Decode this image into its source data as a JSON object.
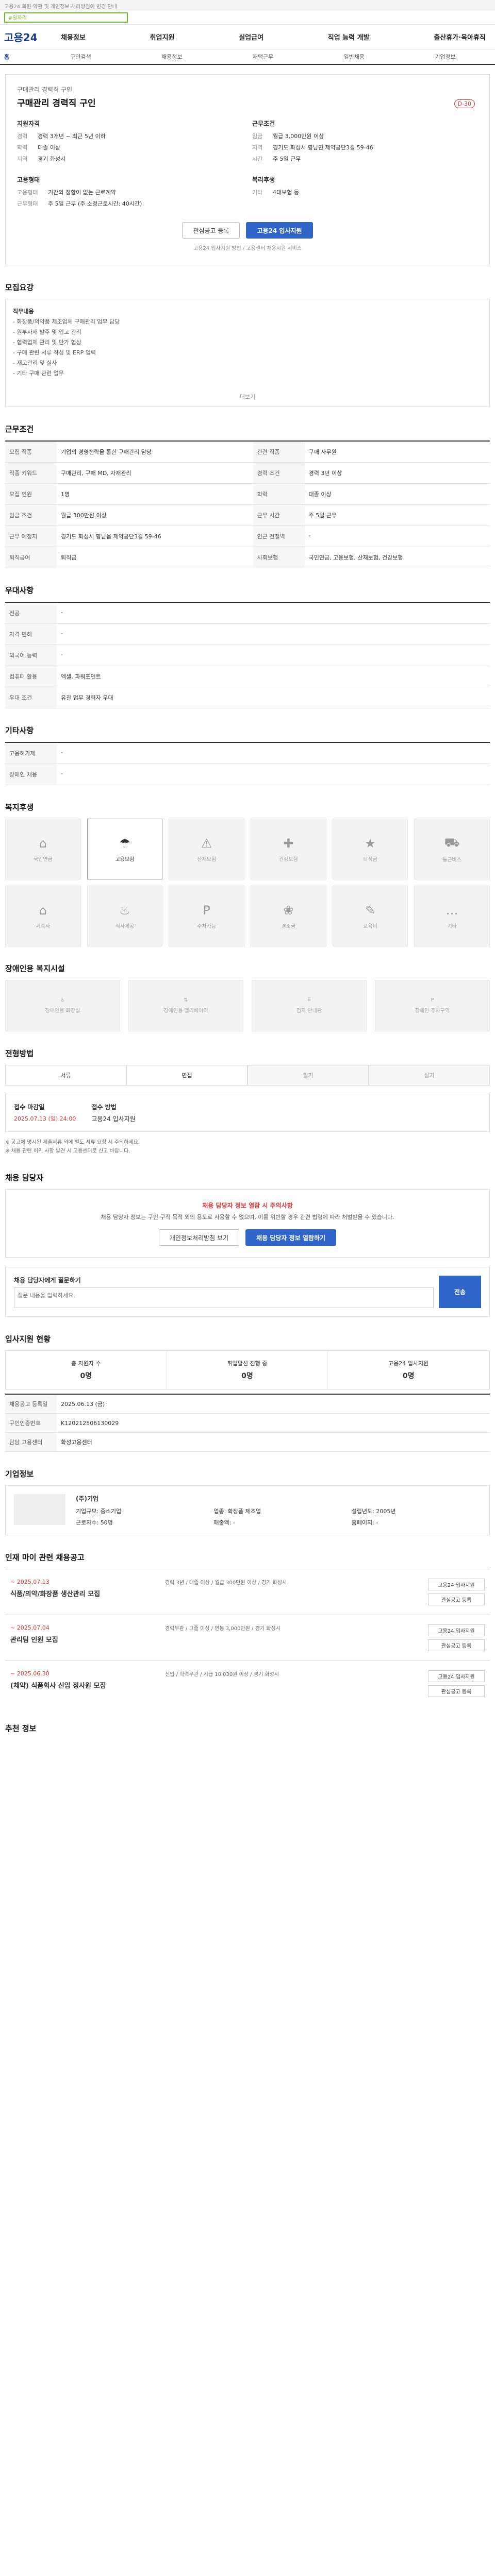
{
  "top_notice": "고용24 회원 약관 및 개인정보 처리방침이 변경 안내",
  "search": {
    "tag": "#일자리"
  },
  "header": {
    "logo": "고용24",
    "gnb": [
      "채용정보",
      "취업지원",
      "실업급여",
      "직업 능력 개발",
      "출산휴가·육아휴직"
    ]
  },
  "subnav": [
    "홈",
    "구인검색",
    "채용정보",
    "재택근무",
    "일반채용",
    "기업정보"
  ],
  "job": {
    "company": "구매관리 경력직 구인",
    "title": "구매관리 경력직 구인",
    "dday": "D-30",
    "left_title": "지원자격",
    "left": [
      [
        "경력",
        "경력 3개년 ~ 최근 5년 이하"
      ],
      [
        "학력",
        "대졸 이상"
      ],
      [
        "지역",
        "경기 화성시"
      ]
    ],
    "right_title": "근무조건",
    "right": [
      [
        "임금",
        "월급 3,000만원 이상"
      ],
      [
        "지역",
        "경기도 화성시 향남면 제약공단3길 59-46"
      ],
      [
        "시간",
        "주 5일 근무"
      ]
    ],
    "left2_title": "고용형태",
    "left2": [
      [
        "고용형태",
        "기간의 정함이 없는 근로계약"
      ],
      [
        "근무형태",
        "주 5일 근무 (주 소정근로시간: 40시간)"
      ]
    ],
    "right2_title": "복리후생",
    "right2": [
      [
        "기타",
        "4대보험 등"
      ]
    ],
    "btn_scrap": "관심공고 등록",
    "btn_apply": "고용24 입사지원",
    "note": "고용24 입사지원 방법 / 고용센터 채용지원 서비스"
  },
  "sections": {
    "recruit_detail": "모집요강",
    "work_cond": "근무조건",
    "qualification": "우대사항",
    "other": "기타사항",
    "welfare": "복지후생",
    "disability": "장애인용 복지시설",
    "apply": "전형방법",
    "manager": "채용 담당자",
    "status": "입사지원 현황",
    "company_info": "기업정보",
    "related": "인재 마이 관련 채용공고",
    "similar": "추천 정보"
  },
  "recruit_text": [
    "직무내용",
    "- 화장품/의약품 제조업체 구매관리 업무 담당",
    "- 원부자재 발주 및 입고 관리",
    "- 협력업체 관리 및 단가 협상",
    "- 구매 관련 서류 작성 및 ERP 입력",
    "- 재고관리 및 실사",
    "- 기타 구매 관련 업무"
  ],
  "more": "더보기",
  "work_rows": [
    [
      "모집 직종",
      "기업의 경영전략을 통한 구매관리 담당",
      "관련 직종",
      "구매 사무원"
    ],
    [
      "직종 키워드",
      "구매관리, 구매 MD, 자재관리",
      "경력 조건",
      "경력 3년 이상"
    ],
    [
      "모집 인원",
      "1명",
      "학력",
      "대졸 이상"
    ],
    [
      "임금 조건",
      "월급 300만원 이상",
      "근무 시간",
      "주 5일 근무"
    ],
    [
      "근무 예정지",
      "경기도 화성시 향남읍 제약공단3길 59-46",
      "인근 전철역",
      "-"
    ],
    [
      "퇴직급여",
      "퇴직금",
      "사회보험",
      "국민연금, 고용보험, 산재보험, 건강보험"
    ]
  ],
  "qual_rows": [
    [
      "전공",
      "-"
    ],
    [
      "자격 면허",
      "-"
    ],
    [
      "외국어 능력",
      "-"
    ],
    [
      "컴퓨터 활용",
      "엑셀, 파워포인트"
    ],
    [
      "우대 조건",
      "유관 업무 경력자 우대"
    ]
  ],
  "other_rows": [
    [
      "고용허가제",
      "-"
    ],
    [
      "장애인 채용",
      "-"
    ]
  ],
  "welfare_icons": [
    "국민연금",
    "고용보험",
    "산재보험",
    "건강보험",
    "퇴직금",
    "통근버스",
    "기숙사",
    "식사제공",
    "주차가능",
    "경조금",
    "교육비",
    "기타"
  ],
  "welfare_active": [
    1
  ],
  "disability_cards": [
    "장애인용 화장실",
    "장애인용 엘리베이터",
    "점자 안내판",
    "장애인 주차구역"
  ],
  "apply_steps": [
    "서류",
    "면접",
    "필기",
    "실기"
  ],
  "deadline": {
    "label": "접수 마감일",
    "date": "2025.07.13 (일) 24:00",
    "method_label": "접수 방법",
    "method": "고용24 입사지원"
  },
  "notices": [
    "※ 공고에 명시된 제출서류 외에 별도 서류 요청 시 주의하세요.",
    "※ 채용 관련 허위 사항 발견 시 고용센터로 신고 바랍니다."
  ],
  "manager": {
    "warn": "채용 담당자 정보 열람 시 주의사항",
    "text": "채용 담당자 정보는 구인·구직 목적 외의 용도로 사용할 수 없으며, 이를 위반할 경우 관련 법령에 따라 처벌받을 수 있습니다.",
    "btn1": "개인정보처리방침 보기",
    "btn2": "채용 담당자 정보 열람하기"
  },
  "report": {
    "label": "채용 담당자에게 질문하기",
    "placeholder": "질문 내용을 입력하세요.",
    "submit": "전송"
  },
  "status_cells": [
    [
      "총 지원자 수",
      "0명"
    ],
    [
      "취업알선 진행 중",
      "0명"
    ],
    [
      "고용24 입사지원",
      "0명"
    ]
  ],
  "info_rows": [
    [
      "채용공고 등록일",
      "2025.06.13 (금)"
    ],
    [
      "구인인증번호",
      "K120212506130029"
    ],
    [
      "담당 고용센터",
      "화성고용센터"
    ]
  ],
  "company": {
    "name": "(주)기업",
    "grid": [
      [
        "기업규모",
        "중소기업"
      ],
      [
        "업종",
        "화장품 제조업"
      ],
      [
        "설립년도",
        "2005년"
      ],
      [
        "근로자수",
        "50명"
      ],
      [
        "매출액",
        "-"
      ],
      [
        "홈페이지",
        "-"
      ]
    ]
  },
  "related_items": [
    {
      "date": "~ 2025.07.13",
      "title": "식품/의약/화장품 생산관리 모집",
      "info": "경력 3년 / 대졸 이상 / 월급 300만원 이상 / 경기 화성시",
      "b1": "고용24 입사지원",
      "b2": "관심공고 등록"
    },
    {
      "date": "~ 2025.07.04",
      "title": "관리팀 인원 모집",
      "info": "경력무관 / 고졸 이상 / 연봉 3,000만원 / 경기 화성시",
      "b1": "고용24 입사지원",
      "b2": "관심공고 등록"
    },
    {
      "date": "~ 2025.06.30",
      "title": "(체약) 식품회사 신입 정사원 모집",
      "info": "신입 / 학력무관 / 시급 10,030원 이상 / 경기 화성시",
      "b1": "고용24 입사지원",
      "b2": "관심공고 등록"
    }
  ]
}
